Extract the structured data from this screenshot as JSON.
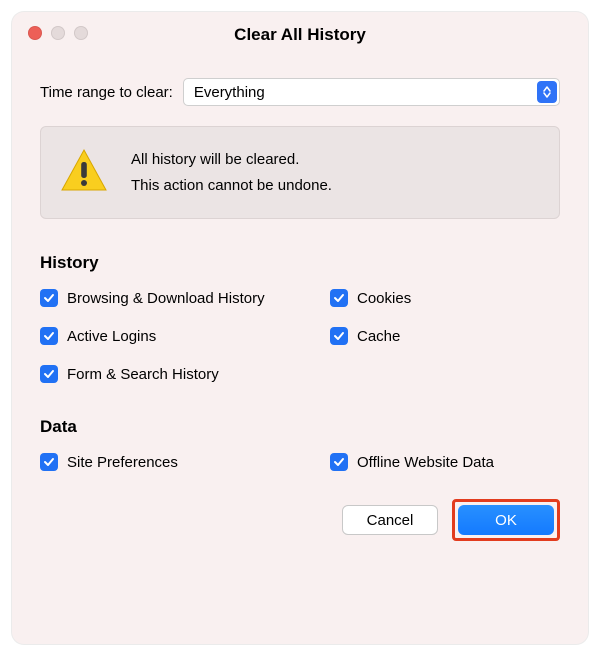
{
  "window": {
    "title": "Clear All History"
  },
  "range": {
    "label": "Time range to clear:",
    "value": "Everything"
  },
  "warning": {
    "line1": "All history will be cleared.",
    "line2": "This action cannot be undone."
  },
  "sections": {
    "history": {
      "heading": "History",
      "items": [
        {
          "label": "Browsing & Download History",
          "checked": true
        },
        {
          "label": "Cookies",
          "checked": true
        },
        {
          "label": "Active Logins",
          "checked": true
        },
        {
          "label": "Cache",
          "checked": true
        },
        {
          "label": "Form & Search History",
          "checked": true
        }
      ]
    },
    "data": {
      "heading": "Data",
      "items": [
        {
          "label": "Site Preferences",
          "checked": true
        },
        {
          "label": "Offline Website Data",
          "checked": true
        }
      ]
    }
  },
  "buttons": {
    "cancel": "Cancel",
    "ok": "OK"
  }
}
